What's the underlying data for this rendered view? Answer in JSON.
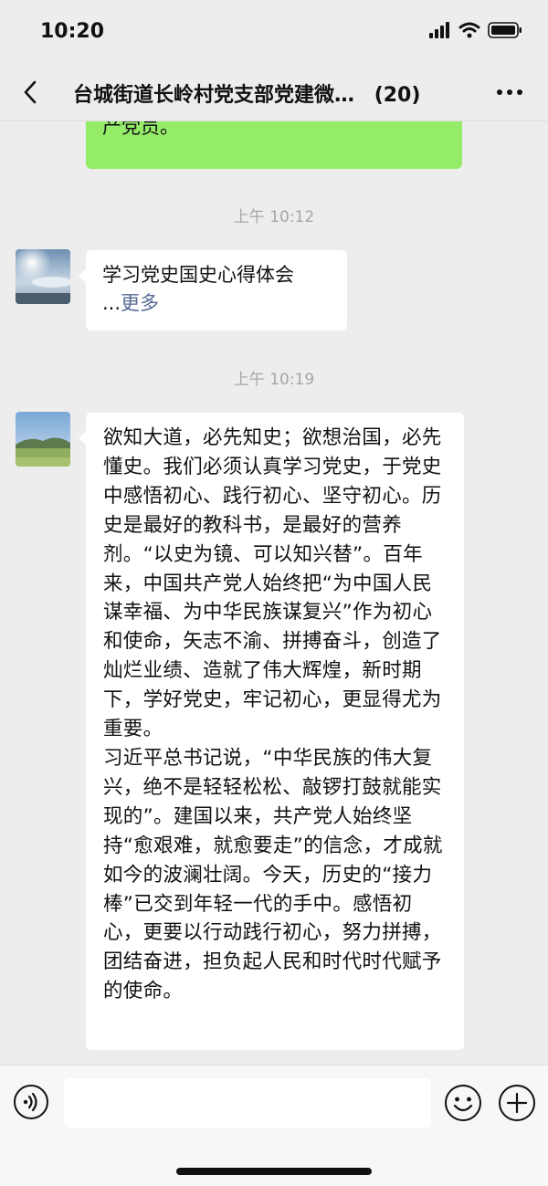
{
  "status_bar": {
    "time": "10:20"
  },
  "nav": {
    "title": "台城街道长岭村党支部党建微…",
    "member_count": "(20)"
  },
  "messages": [
    {
      "type": "sent_partial",
      "visible_lines": [
        "",
        "产党员。"
      ]
    },
    {
      "type": "time",
      "text": "上午 10:12"
    },
    {
      "type": "received",
      "title": "学习党史国史心得体会",
      "ellipsis": "...",
      "more": "更多"
    },
    {
      "type": "time",
      "text": "上午 10:19"
    },
    {
      "type": "received",
      "text": "欲知大道，必先知史；欲想治国，必先懂史。我们必须认真学习党史，于党史中感悟初心、践行初心、坚守初心。历史是最好的教科书，是最好的营养剂。“以史为镜、可以知兴替”。百年来，中国共产党人始终把“为中国人民谋幸福、为中华民族谋复兴”作为初心和使命，矢志不渝、拼搏奋斗，创造了灿烂业绩、造就了伟大辉煌，新时期下，学好党史，牢记初心，更显得尤为重要。\n习近平总书记说，“中华民族的伟大复兴，绝不是轻轻松松、敲锣打鼓就能实现的”。建国以来，共产党人始终坚持“愈艰难，就愈要走”的信念，才成就如今的波澜壮阔。今天，历史的“接力棒”已交到年轻一代的手中。感悟初心，更要以行动践行初心，努力拼搏，团结奋进，担负起人民和时代时代赋予的使命。"
    }
  ],
  "input": {
    "value": ""
  },
  "icons": {
    "back": "chevron-left-icon",
    "more": "ellipsis-icon",
    "voice": "voice-icon",
    "emoji": "emoji-icon",
    "plus": "plus-icon"
  },
  "colors": {
    "sent_bubble": "#95ec69",
    "link": "#576b95",
    "background": "#ededed"
  }
}
